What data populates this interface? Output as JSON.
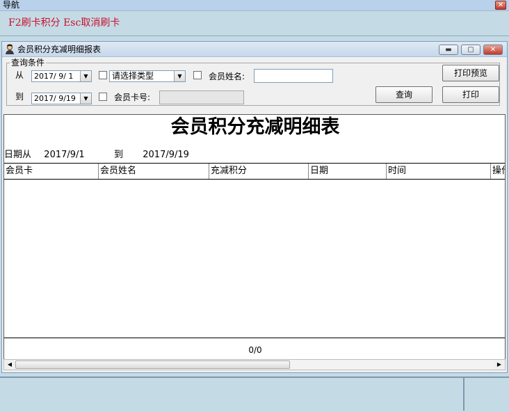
{
  "nav": {
    "title": "导航",
    "close_glyph": "✕",
    "hotkeys": "F2刷卡积分 Esc取消刷卡"
  },
  "window": {
    "icon": "person-icon",
    "title": "会员积分充减明细报表",
    "minimize_glyph": "▬",
    "maximize_glyph": "▢",
    "close_glyph": "✕"
  },
  "query": {
    "legend": "查询条件",
    "from_label": "从",
    "to_label": "到",
    "from_date": "2017/ 9/ 1",
    "to_date": "2017/ 9/19",
    "type_select": "请选择类型",
    "member_name_label": "会员姓名:",
    "member_name_value": "",
    "card_no_label": "会员卡号:",
    "card_no_value": "",
    "dropdown_glyph": "▼",
    "print_preview_button": "打印预览",
    "query_button": "查询",
    "print_button": "打印"
  },
  "report": {
    "title": "会员积分充减明细表",
    "date_from_label": "日期从",
    "date_from": "2017/9/1",
    "date_to_label": "到",
    "date_to": "2017/9/19",
    "columns": [
      "会员卡",
      "会员姓名",
      "充减积分",
      "日期",
      "时间",
      "操作"
    ],
    "page_count": "0/0"
  },
  "scrollbar": {
    "left_glyph": "◀",
    "right_glyph": "▶"
  },
  "colors": {
    "hotkey_text": "#c8102e",
    "background": "#c4dbe6"
  }
}
